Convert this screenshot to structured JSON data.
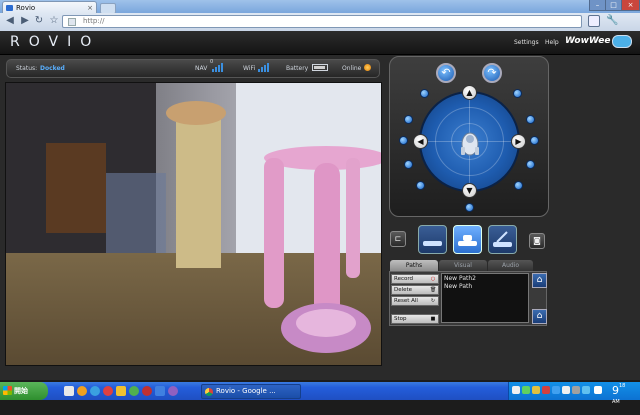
{
  "browser": {
    "tab_title": "Rovio",
    "tab_close": "×",
    "address": "http://",
    "window_controls": [
      "–",
      "□",
      "×"
    ],
    "nav": {
      "back": "◀",
      "forward": "▶",
      "reload": "↻",
      "star": "☆"
    },
    "menu_icons": [
      "page-icon",
      "wrench-icon"
    ]
  },
  "app": {
    "logo": "ROVIO",
    "links": [
      "Settings",
      "Help"
    ],
    "brand": "WowWee"
  },
  "status": {
    "status_label": "Status:",
    "status_value": "Docked",
    "nav_label": "NAV",
    "nav_value": "0",
    "wifi_label": "WiFi",
    "battery_label": "Battery",
    "battery_level": 0.9,
    "online_label": "Online"
  },
  "controls": {
    "rotate_left_icon": "rotate-left-icon",
    "rotate_right_icon": "rotate-right-icon",
    "arrows": {
      "up": "▲",
      "down": "▼",
      "left": "◀",
      "right": "▶"
    },
    "head_positions": [
      "head-low",
      "head-mid",
      "head-high"
    ],
    "active_head_position": "head-mid",
    "camera_icon": "camera-icon",
    "light_icon": "headlight-icon"
  },
  "tabs": [
    "Paths",
    "Visual",
    "Audio"
  ],
  "active_tab": "Paths",
  "paths": {
    "buttons": [
      {
        "label": "Record",
        "icon": "○"
      },
      {
        "label": "Delete",
        "icon": "🗑"
      },
      {
        "label": "Reset All",
        "icon": "↻"
      },
      {
        "label": "Stop",
        "icon": "■"
      }
    ],
    "items": [
      "New Path2",
      "New Path"
    ]
  },
  "taskbar": {
    "start_label": "開始",
    "task_label": "Rovio - Google ...",
    "clock_hour": "9",
    "clock_minute": "18",
    "clock_ampm": "AM"
  },
  "colors": {
    "accent": "#3a8fe0",
    "status_value": "#5ab0ff",
    "background": "#2a2a2a"
  }
}
